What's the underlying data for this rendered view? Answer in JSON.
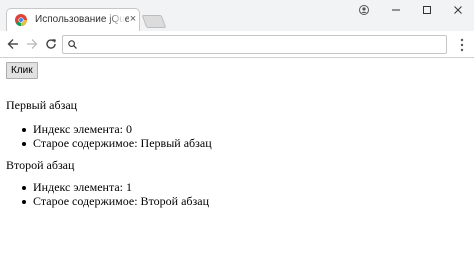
{
  "browser": {
    "tab_title": "Использование jQuery",
    "tab_close": "×",
    "address": ""
  },
  "page": {
    "button_label": "Клик",
    "blocks": [
      {
        "paragraph": "Первый абзац",
        "items": [
          "Индекс элемента: 0",
          "Старое содержимое: Первый абзац"
        ]
      },
      {
        "paragraph": "Второй абзац",
        "items": [
          "Индекс элемента: 1",
          "Старое содержимое: Второй абзац"
        ]
      }
    ]
  }
}
